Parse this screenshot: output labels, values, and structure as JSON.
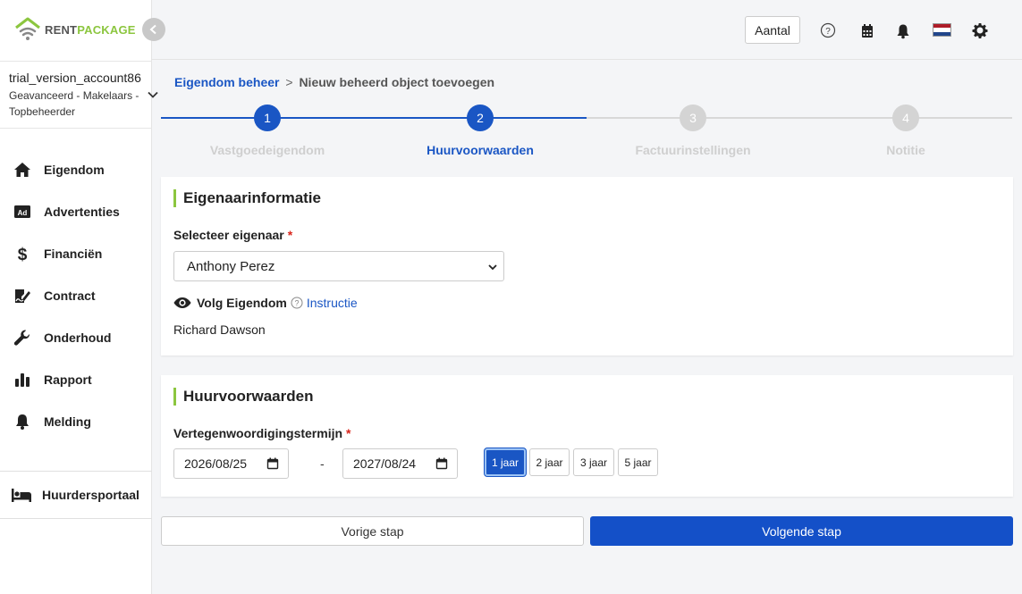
{
  "brand": {
    "name_part1": "RENT",
    "name_part2": "PACKAGE",
    "logo_color": "#8cc63f"
  },
  "account": {
    "name": "trial_version_account86",
    "role": "Geavanceerd - Makelaars - Topbeheerder"
  },
  "sidebar": {
    "items": [
      {
        "label": "Eigendom",
        "icon": "home-icon"
      },
      {
        "label": "Advertenties",
        "icon": "ad-icon"
      },
      {
        "label": "Financiën",
        "icon": "dollar-icon"
      },
      {
        "label": "Contract",
        "icon": "contract-icon"
      },
      {
        "label": "Onderhoud",
        "icon": "wrench-icon"
      },
      {
        "label": "Rapport",
        "icon": "bar-chart-icon"
      },
      {
        "label": "Melding",
        "icon": "bell-icon"
      }
    ],
    "portal": {
      "label": "Huurdersportaal",
      "icon": "bed-icon"
    }
  },
  "header": {
    "aantal_label": "Aantal",
    "icons": [
      "help-icon",
      "calendar-icon",
      "bell-icon",
      "flag-nl-icon",
      "gear-icon"
    ]
  },
  "breadcrumb": {
    "parent": "Eigendom beheer",
    "separator": ">",
    "current": "Nieuw beheerd object toevoegen"
  },
  "stepper": {
    "accent": "#1a56c4",
    "steps": [
      {
        "number": "1",
        "label": "Vastgoedeigendom",
        "state": "done"
      },
      {
        "number": "2",
        "label": "Huurvoorwaarden",
        "state": "active"
      },
      {
        "number": "3",
        "label": "Factuurinstellingen",
        "state": "pending"
      },
      {
        "number": "4",
        "label": "Notitie",
        "state": "pending"
      }
    ]
  },
  "owner_card": {
    "title": "Eigenaarinformatie",
    "select_label": "Selecteer eigenaar",
    "required_mark": "*",
    "selected_owner": "Anthony Perez",
    "follow_label": "Volg Eigendom",
    "instruction_link": "Instructie",
    "follower_name": "Richard Dawson"
  },
  "terms_card": {
    "title": "Huurvoorwaarden",
    "term_label": "Vertegenwoordigingstermijn",
    "required_mark": "*",
    "start_date": "2026/08/25",
    "end_date": "2027/08/24",
    "range_separator": "-",
    "term_options": [
      "1 jaar",
      "2 jaar",
      "3 jaar",
      "5 jaar"
    ],
    "selected_term": "1 jaar"
  },
  "actions": {
    "prev_label": "Vorige stap",
    "next_label": "Volgende stap"
  }
}
